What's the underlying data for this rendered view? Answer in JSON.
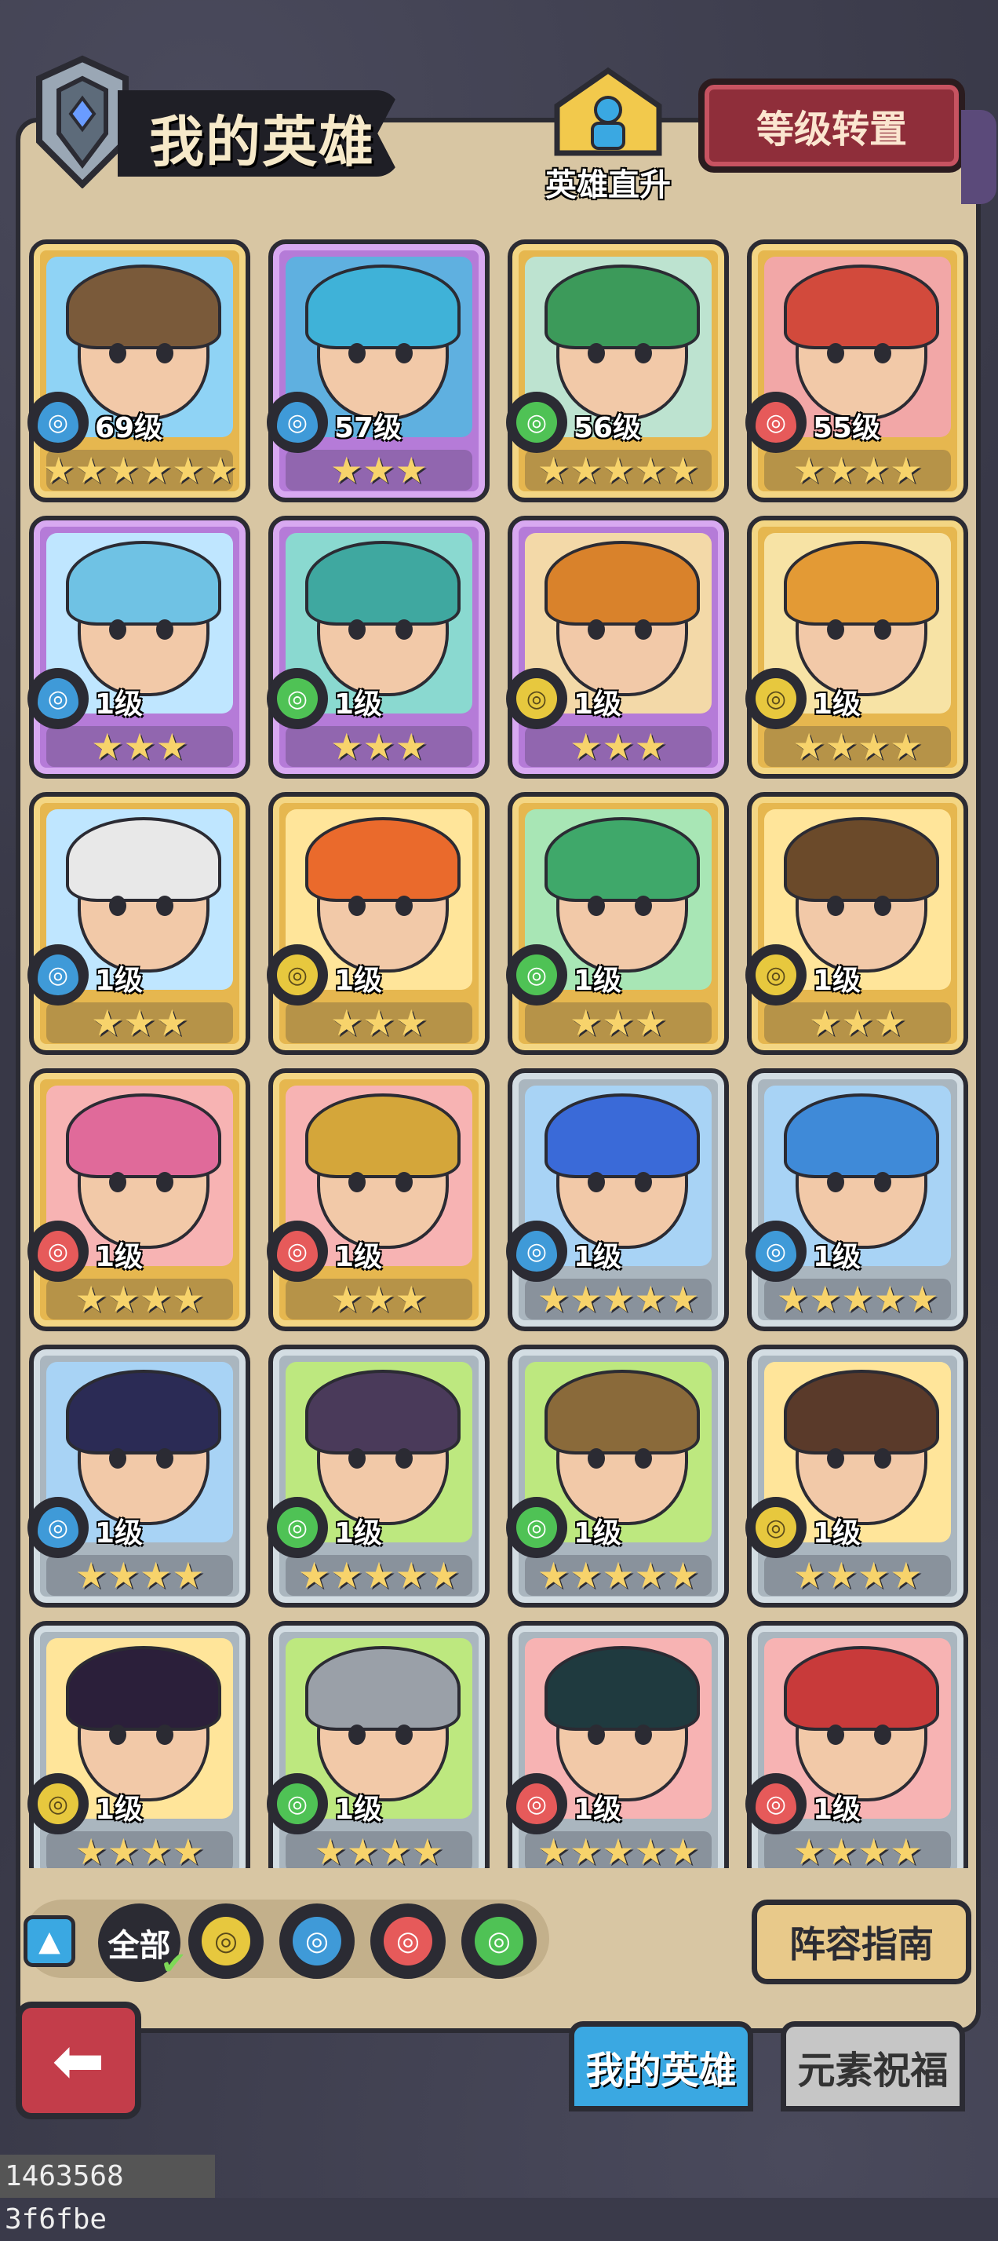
{
  "header": {
    "title": "我的英雄",
    "direct_upgrade_label": "英雄直升",
    "level_transfer_label": "等级转置"
  },
  "heroes": [
    {
      "level": "69级",
      "element": "water",
      "stars": "★★★★★★",
      "rarity": "gold"
    },
    {
      "level": "57级",
      "element": "water",
      "stars": "★★★",
      "rarity": "purple"
    },
    {
      "level": "56级",
      "element": "wind",
      "stars": "★★★★★",
      "rarity": "gold"
    },
    {
      "level": "55级",
      "element": "fire",
      "stars": "★★★★",
      "rarity": "gold"
    },
    {
      "level": "1级",
      "element": "water",
      "stars": "★★★",
      "rarity": "purple"
    },
    {
      "level": "1级",
      "element": "wind",
      "stars": "★★★",
      "rarity": "purple"
    },
    {
      "level": "1级",
      "element": "earth",
      "stars": "★★★",
      "rarity": "purple"
    },
    {
      "level": "1级",
      "element": "earth",
      "stars": "★★★★",
      "rarity": "gold"
    },
    {
      "level": "1级",
      "element": "water",
      "stars": "★★★",
      "rarity": "gold"
    },
    {
      "level": "1级",
      "element": "earth",
      "stars": "★★★",
      "rarity": "gold"
    },
    {
      "level": "1级",
      "element": "wind",
      "stars": "★★★",
      "rarity": "gold"
    },
    {
      "level": "1级",
      "element": "earth",
      "stars": "★★★",
      "rarity": "gold"
    },
    {
      "level": "1级",
      "element": "fire",
      "stars": "★★★★",
      "rarity": "gold"
    },
    {
      "level": "1级",
      "element": "fire",
      "stars": "★★★",
      "rarity": "gold"
    },
    {
      "level": "1级",
      "element": "water",
      "stars": "★★★★★",
      "rarity": "silver"
    },
    {
      "level": "1级",
      "element": "water",
      "stars": "★★★★★",
      "rarity": "silver"
    },
    {
      "level": "1级",
      "element": "water",
      "stars": "★★★★",
      "rarity": "silver"
    },
    {
      "level": "1级",
      "element": "wind",
      "stars": "★★★★★",
      "rarity": "silver"
    },
    {
      "level": "1级",
      "element": "wind",
      "stars": "★★★★★",
      "rarity": "silver"
    },
    {
      "level": "1级",
      "element": "earth",
      "stars": "★★★★",
      "rarity": "silver"
    },
    {
      "level": "1级",
      "element": "earth",
      "stars": "★★★★",
      "rarity": "silver"
    },
    {
      "level": "1级",
      "element": "wind",
      "stars": "★★★★",
      "rarity": "silver"
    },
    {
      "level": "1级",
      "element": "fire",
      "stars": "★★★★★",
      "rarity": "silver"
    },
    {
      "level": "1级",
      "element": "fire",
      "stars": "★★★★",
      "rarity": "silver"
    }
  ],
  "filters": {
    "all_label": "全部",
    "elements": [
      "earth",
      "water",
      "fire",
      "wind"
    ],
    "collapse_icon": "chevron-up-icon"
  },
  "lineup_guide_label": "阵容指南",
  "tabs": {
    "my_heroes": "我的英雄",
    "element_blessing": "元素祝福"
  },
  "footer_id": "1463568 3f6fbe",
  "colors": {
    "water": "#3f9ad8",
    "wind": "#4fc255",
    "fire": "#e65a5a",
    "earth": "#e7c83e",
    "gold_card": "#e6b74f",
    "purple_card": "#b57bd8",
    "silver_card": "#aab6bf"
  }
}
